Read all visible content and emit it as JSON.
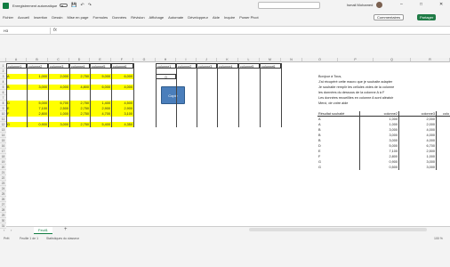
{
  "titlebar": {
    "autosave_label": "Enregistrement automatique",
    "doc_title": "",
    "user_name": "Ismail Mohamed"
  },
  "ribbon": {
    "tabs": [
      "Fichier",
      "Accueil",
      "Insertion",
      "Dessin",
      "Mise en page",
      "Formules",
      "Données",
      "Révision",
      "Affichage",
      "Automate",
      "Développeur",
      "Aide",
      "Inquire",
      "Power Pivot"
    ],
    "comments_label": "Commentaires",
    "share_label": "Partager"
  },
  "formula_bar": {
    "name_box": "H3",
    "formula": ""
  },
  "columns": [
    "A",
    "B",
    "C",
    "D",
    "E",
    "F",
    "G",
    "H",
    "I",
    "J",
    "K",
    "L",
    "M",
    "N",
    "O",
    "P",
    "Q",
    "R"
  ],
  "rows": [
    "1",
    "2",
    "3",
    "4",
    "5",
    "6",
    "7",
    "8",
    "9",
    "10",
    "11",
    "12",
    "13",
    "14",
    "15",
    "16",
    "17",
    "18",
    "19",
    "20",
    "21",
    "22",
    "23",
    "24",
    "25",
    "26",
    "27",
    "28",
    "29",
    "30",
    "31"
  ],
  "left_table": {
    "headers": [
      "colonne1",
      "colonne2",
      "colonne3",
      "colonne4",
      "colonne5",
      "colonne6"
    ],
    "rows": [
      [
        "",
        "",
        "",
        "",
        "",
        ""
      ],
      [
        "A",
        "1,000",
        "2,000",
        "2,750",
        "5,000",
        "6,000"
      ],
      [
        "",
        "",
        "",
        "",
        "",
        ""
      ],
      [
        "B",
        "3,000",
        "4,000",
        "4,800",
        "6,000",
        "4,000"
      ],
      [
        "",
        "",
        "",
        "",
        "",
        ""
      ],
      [
        "",
        "",
        "",
        "",
        "",
        ""
      ],
      [
        "D",
        "5,000",
        "6,700",
        "2,750",
        "1,400",
        "4,500"
      ],
      [
        "E",
        "7,100",
        "2,500",
        "2,750",
        "2,900",
        "2,900"
      ],
      [
        "F",
        "2,800",
        "1,000",
        "2,750",
        "4,700",
        "3,100"
      ],
      [
        "",
        "",
        "",
        "",
        "",
        ""
      ],
      [
        "G",
        "0,900",
        "3,000",
        "2,750",
        "5,400",
        "4,350"
      ]
    ]
  },
  "copie_button": "Copie",
  "right_table": {
    "headers": [
      "colonne1",
      "colonne2",
      "colonne3",
      "colonne4",
      "colonne5",
      "colonne6"
    ],
    "first_value": "0"
  },
  "notes": [
    "Bonjour à Tous,",
    "J'ai récupéré cette macro que je souhaite adapter",
    "Je souhaite remplir les cellules vides de la colonne",
    "les données du dessous de la colonne A à F",
    "Les données recueillies en colonne A sont aléatoir",
    "Merci, de votre aide"
  ],
  "result_table": {
    "headers": [
      "Résultat souhaité",
      "colonne2",
      "colonne3",
      "colo"
    ],
    "rows": [
      [
        "A",
        "1,000",
        "2,000"
      ],
      [
        "A",
        "1,000",
        "2,000"
      ],
      [
        "B",
        "3,000",
        "4,000"
      ],
      [
        "B",
        "3,000",
        "4,000"
      ],
      [
        "B",
        "3,000",
        "4,000"
      ],
      [
        "D",
        "5,000",
        "6,700"
      ],
      [
        "E",
        "7,100",
        "2,500"
      ],
      [
        "F",
        "2,800",
        "1,000"
      ],
      [
        "G",
        "0,900",
        "3,000"
      ],
      [
        "G",
        "0,500",
        "3,000"
      ]
    ]
  },
  "sheet_tab": "Feuil1",
  "status": {
    "left": "Prêt",
    "mid": "Feuille 1 de 1",
    "accessibility": "Statistiques du classeur",
    "zoom": "100 %"
  }
}
